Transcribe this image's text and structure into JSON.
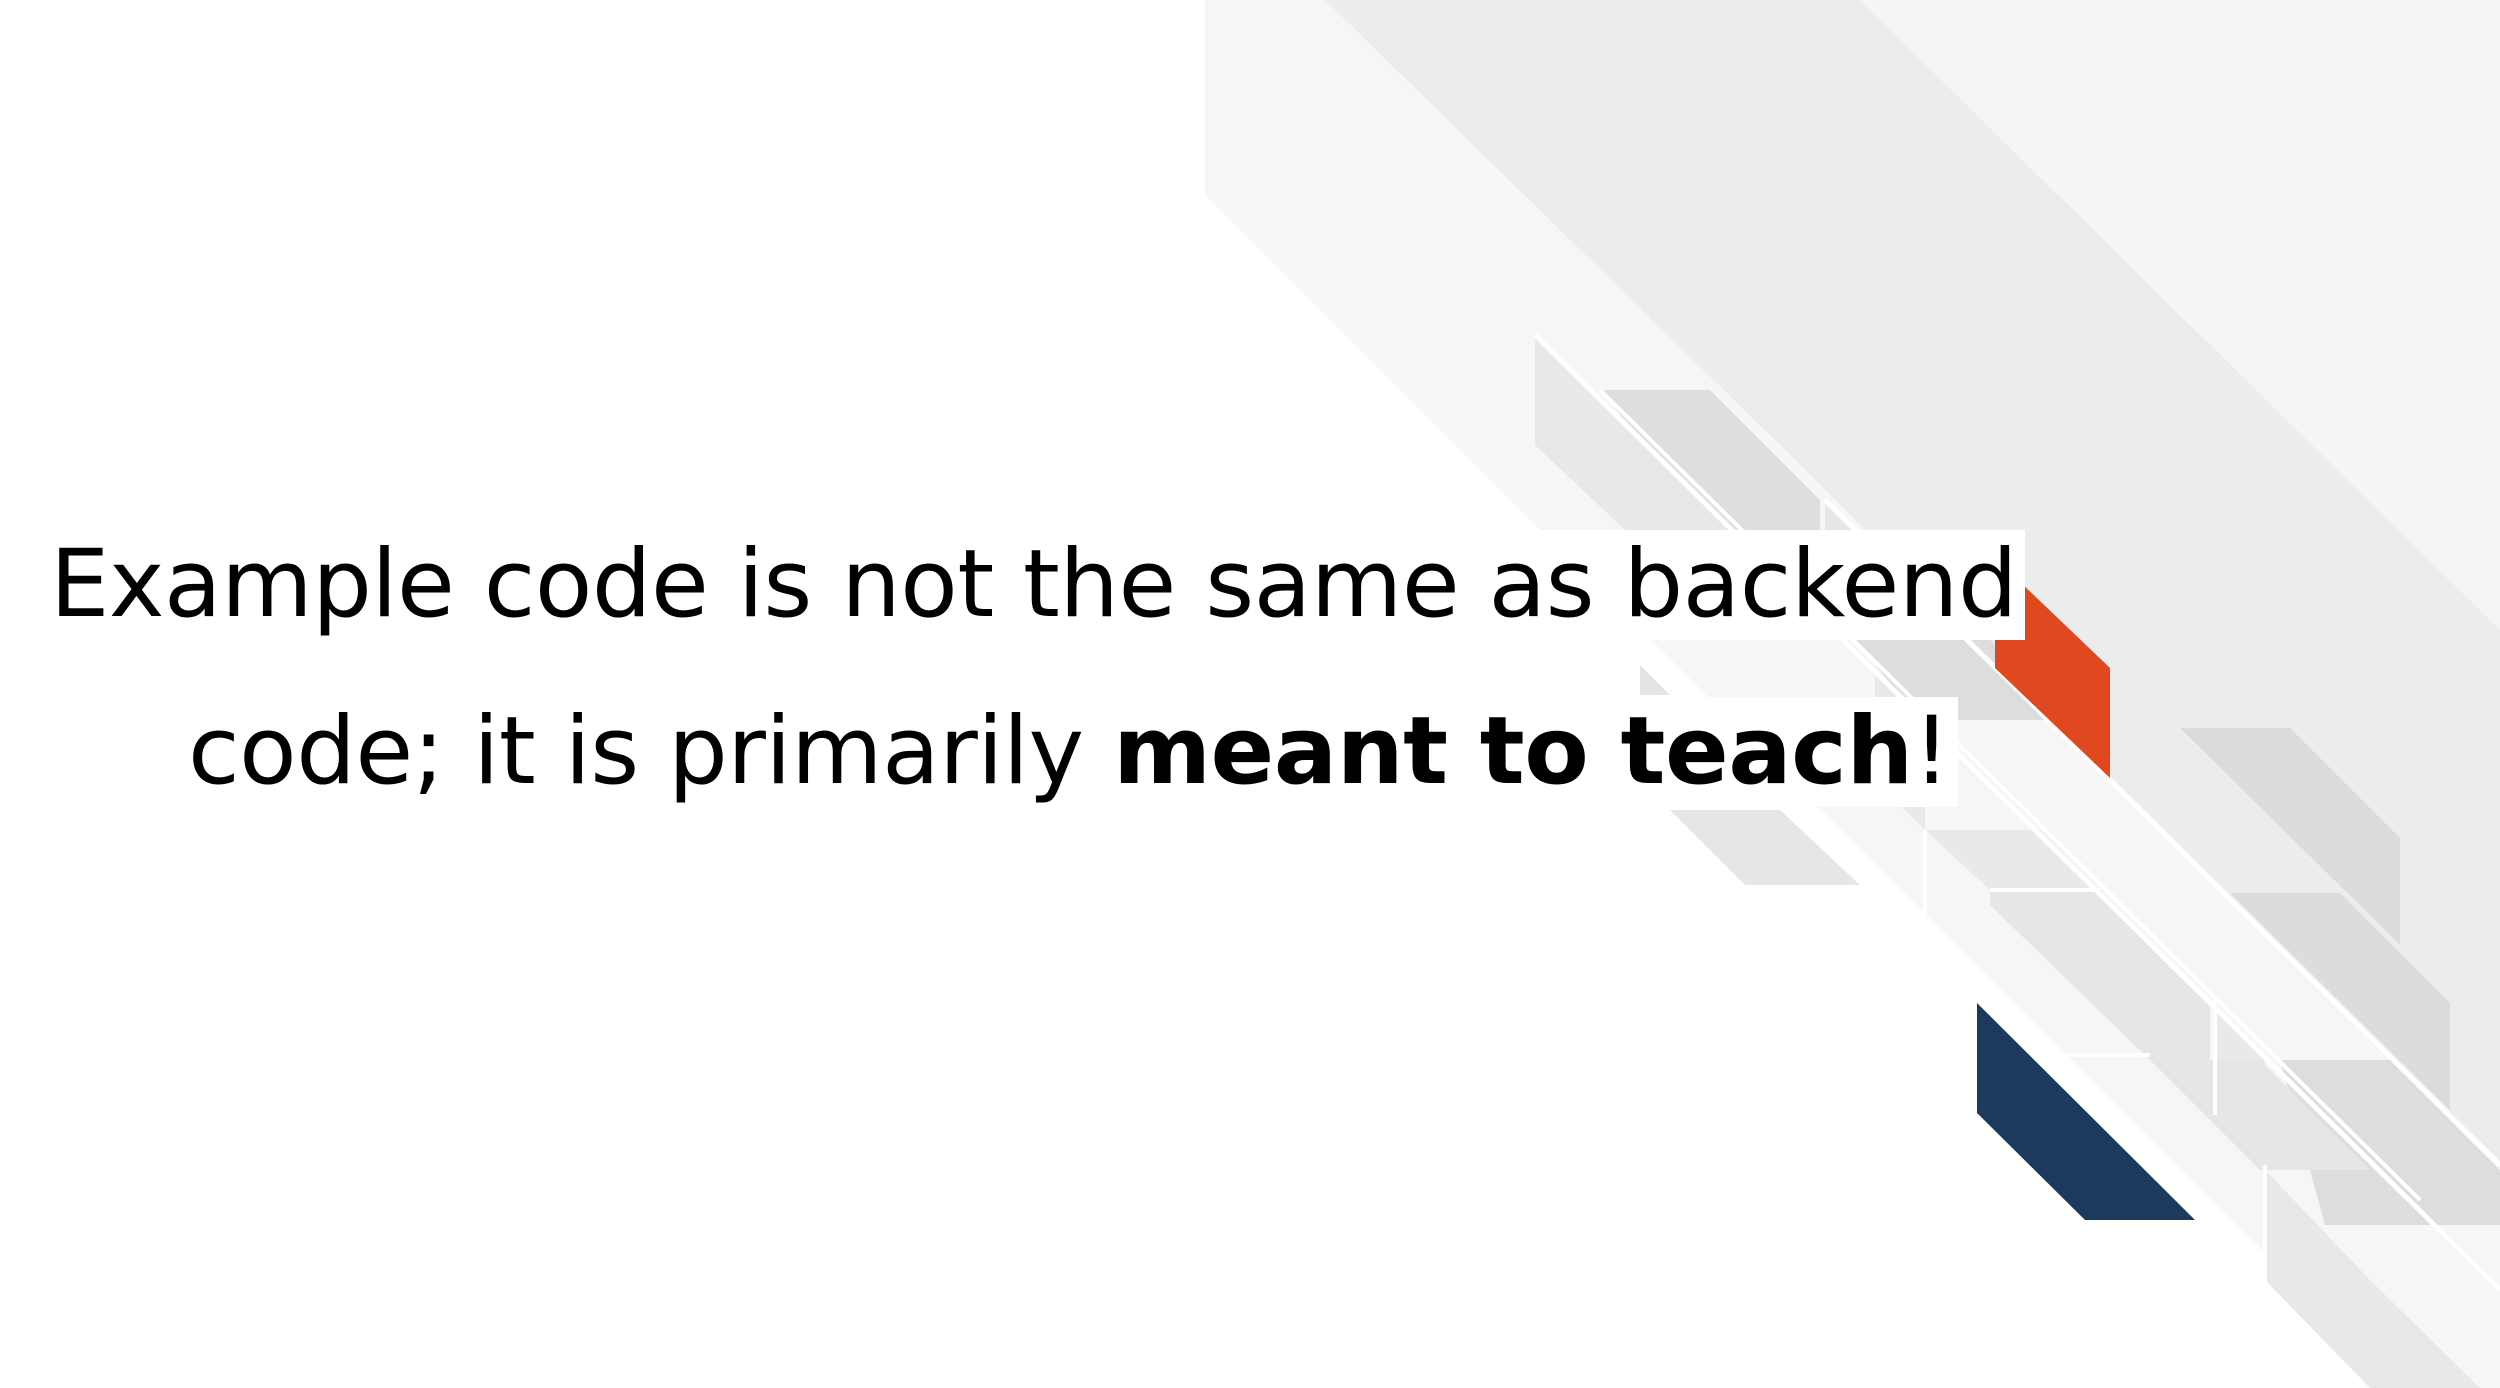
{
  "slide": {
    "line1": "Example code is not the same as backend",
    "line2_prefix": "code; it is primarily ",
    "line2_bold": "meant to teach",
    "line2_suffix": "!"
  },
  "colors": {
    "background": "#ffffff",
    "text": "#000000",
    "accent_orange": "#e0491f",
    "accent_navy": "#1b3a5c",
    "gray_light": "#f4f4f4",
    "gray_mid": "#ececec",
    "gray_dark": "#dcdcdc"
  }
}
